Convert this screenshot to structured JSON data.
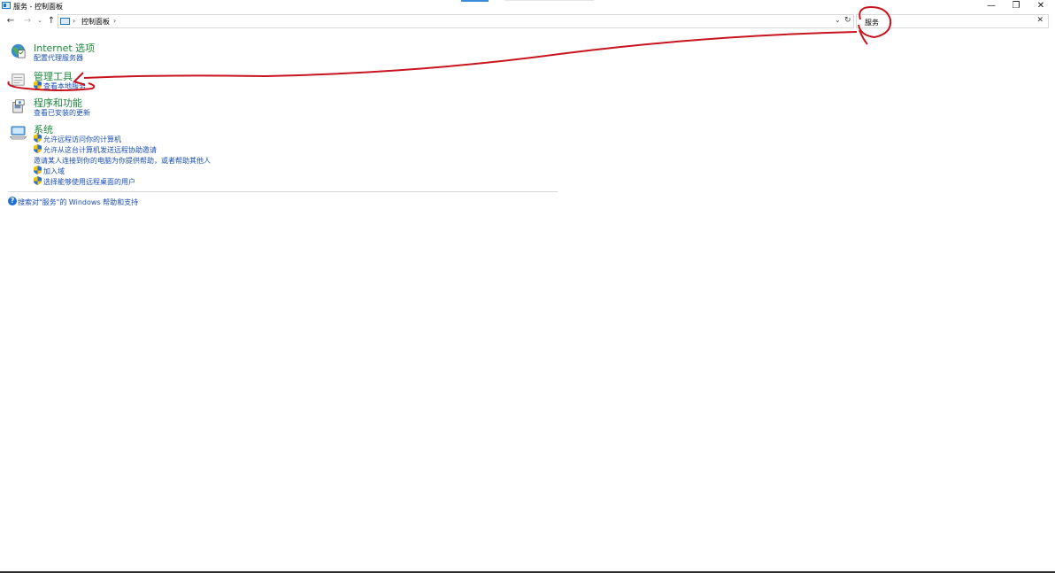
{
  "window": {
    "title": "服务 - 控制面板",
    "minimize_glyph": "—",
    "maximize_glyph": "❐",
    "close_glyph": "✕"
  },
  "nav": {
    "back_glyph": "←",
    "forward_glyph": "→",
    "recent_glyph": "⌄",
    "up_glyph": "↑",
    "breadcrumb_sep": "›",
    "breadcrumb": "控制面板",
    "dropdown_glyph": "⌄",
    "refresh_glyph": "↻"
  },
  "search": {
    "value": "服务",
    "clear_glyph": "✕"
  },
  "groups": [
    {
      "title": "Internet 选项",
      "icon": "globe-icon",
      "links": [
        {
          "label": "配置代理服务器",
          "shield": false
        }
      ]
    },
    {
      "title": "管理工具",
      "icon": "admin-tools-icon",
      "links": [
        {
          "label": "查看本地服务",
          "shield": true
        }
      ]
    },
    {
      "title": "程序和功能",
      "icon": "programs-icon",
      "links": [
        {
          "label": "查看已安装的更新",
          "shield": false
        }
      ]
    },
    {
      "title": "系统",
      "icon": "computer-icon",
      "links": [
        {
          "label": "允许远程访问你的计算机",
          "shield": true
        },
        {
          "label": "允许从这台计算机发送远程协助邀请",
          "shield": true
        },
        {
          "label": "邀请某人连接到你的电脑为你提供帮助，或者帮助其他人",
          "shield": false
        },
        {
          "label": "加入域",
          "shield": true
        },
        {
          "label": "选择能够使用远程桌面的用户",
          "shield": true
        }
      ]
    }
  ],
  "help": {
    "icon_glyph": "?",
    "text": "搜索对\"服务\"的 Windows 帮助和支持"
  },
  "colors": {
    "group_title": "#1e8a3e",
    "link": "#1a4fb5",
    "annotation": "#c8141e"
  }
}
